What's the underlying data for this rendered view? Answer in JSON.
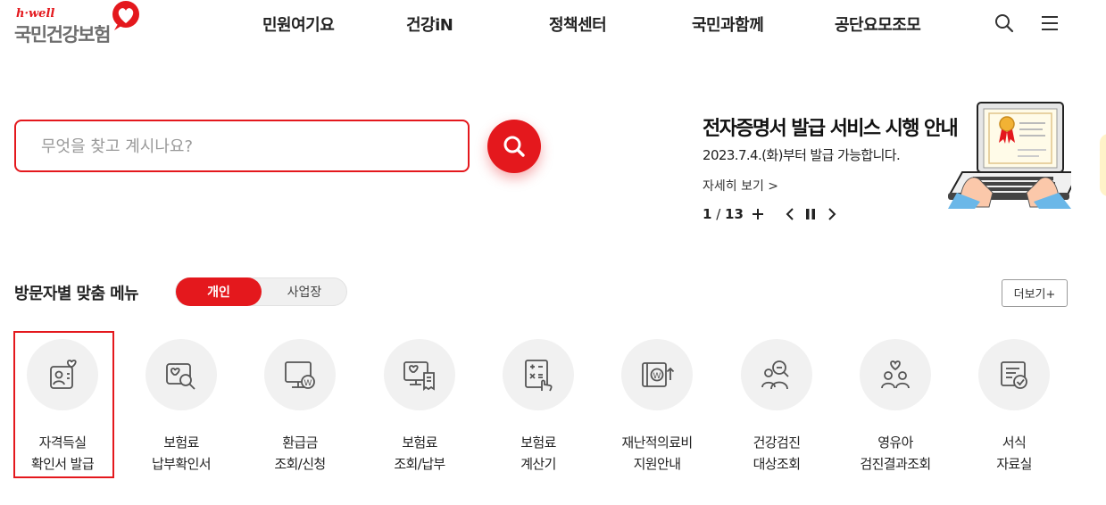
{
  "header": {
    "logo_small": "h·well",
    "logo_main": "국민건강보험",
    "nav": [
      "민원여기요",
      "건강iN",
      "정책센터",
      "국민과함께",
      "공단요모조모"
    ],
    "search_icon": "search-icon",
    "menu_icon": "hamburger-menu-icon"
  },
  "search": {
    "placeholder": "무엇을 찾고 계시나요?",
    "button_icon": "search-icon"
  },
  "banner": {
    "title": "전자증명서 발급 서비스 시행 안내",
    "subtitle": "2023.7.4.(화)부터 발급 가능합니다.",
    "more": "자세히 보기 >",
    "current": "1",
    "separator": " / ",
    "total": "13",
    "image_icon": "laptop-certificate-illustration"
  },
  "menu_section": {
    "title": "방문자별 맞춤 메뉴",
    "toggle": [
      "개인",
      "사업장"
    ],
    "active_toggle": "개인",
    "more": "더보기+",
    "items": [
      {
        "line1": "자격득실",
        "line2": "확인서 발급",
        "icon": "person-heart-card-icon"
      },
      {
        "line1": "보험료",
        "line2": "납부확인서",
        "icon": "heart-magnifier-icon"
      },
      {
        "line1": "환급금",
        "line2": "조회/신청",
        "icon": "monitor-won-icon"
      },
      {
        "line1": "보험료",
        "line2": "조회/납부",
        "icon": "monitor-receipt-icon"
      },
      {
        "line1": "보험료",
        "line2": "계산기",
        "icon": "calculator-hand-icon"
      },
      {
        "line1": "재난적의료비",
        "line2": "지원안내",
        "icon": "wallet-won-icon"
      },
      {
        "line1": "건강검진",
        "line2": "대상조회",
        "icon": "people-search-icon"
      },
      {
        "line1": "영유아",
        "line2": "검진결과조회",
        "icon": "family-heart-icon"
      },
      {
        "line1": "서식",
        "line2": "자료실",
        "icon": "document-check-icon"
      }
    ],
    "highlight_color": "#e4181d"
  },
  "colors": {
    "accent": "#e4181d",
    "text": "#222222",
    "icon_bg": "#f1f1f1"
  }
}
